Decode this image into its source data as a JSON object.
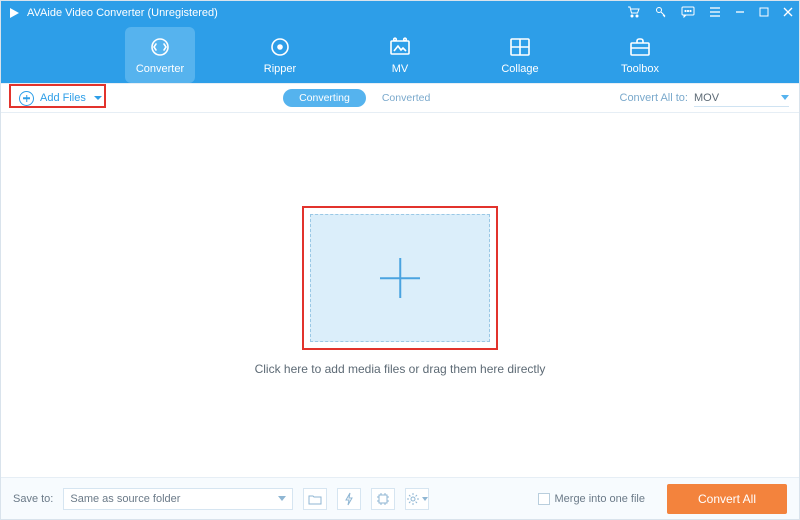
{
  "titlebar": {
    "title": "AVAide Video Converter (Unregistered)"
  },
  "nav": {
    "items": [
      {
        "label": "Converter"
      },
      {
        "label": "Ripper"
      },
      {
        "label": "MV"
      },
      {
        "label": "Collage"
      },
      {
        "label": "Toolbox"
      }
    ]
  },
  "subbar": {
    "add_files_label": "Add Files",
    "toggle": {
      "converting": "Converting",
      "converted": "Converted"
    },
    "convert_all_label": "Convert All to:",
    "format_selected": "MOV"
  },
  "main": {
    "hint": "Click here to add media files or drag them here directly"
  },
  "bottombar": {
    "save_to_label": "Save to:",
    "save_to_value": "Same as source folder",
    "merge_label": "Merge into one file",
    "convert_all_btn": "Convert All"
  }
}
